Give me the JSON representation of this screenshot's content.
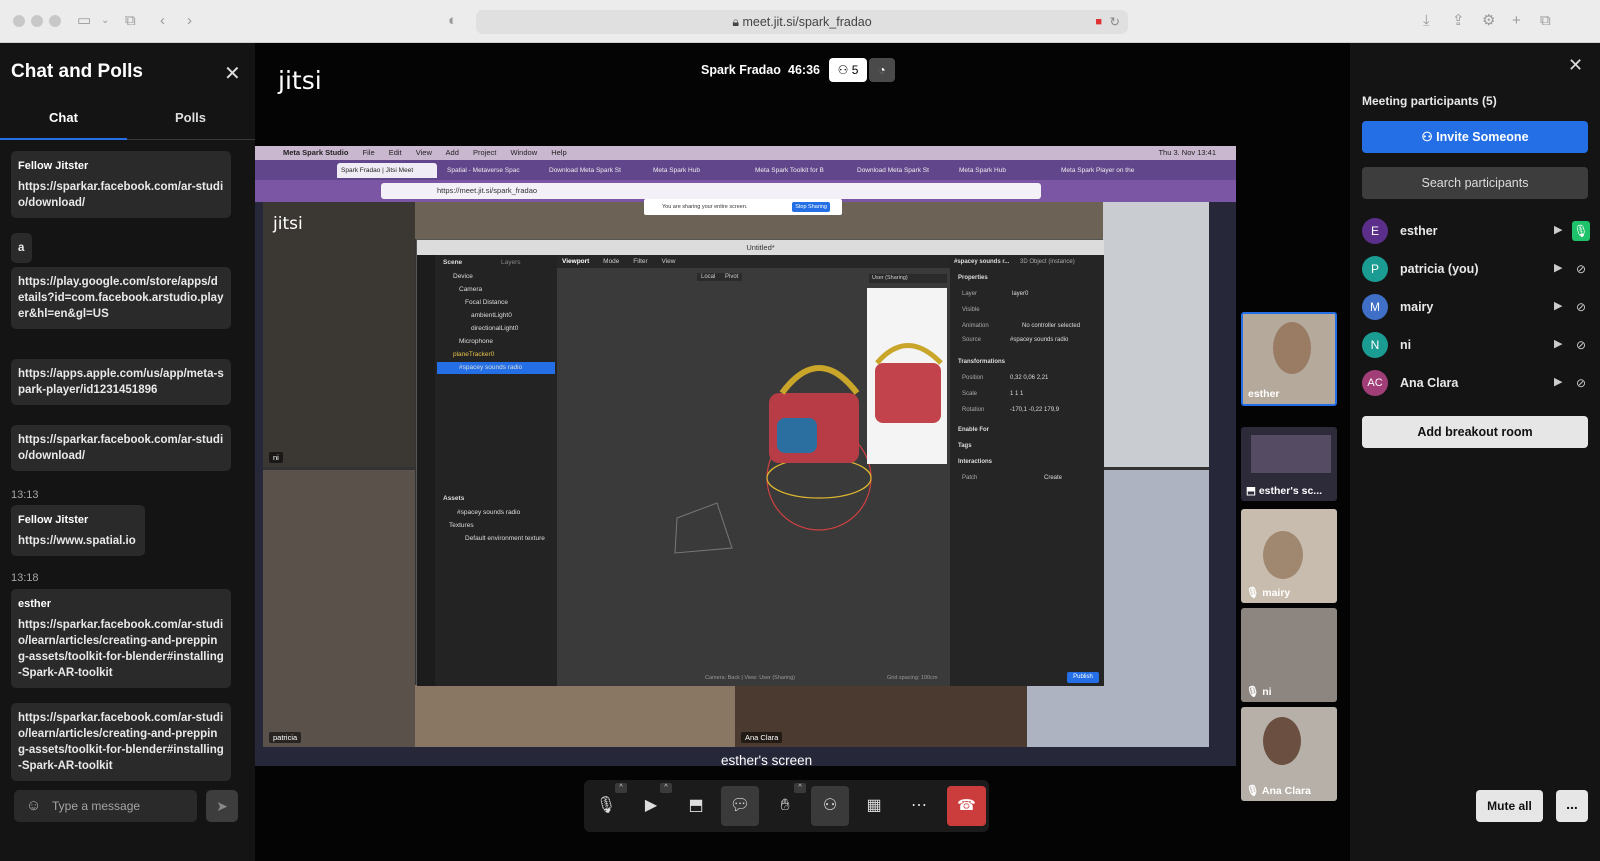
{
  "browser": {
    "url": "meet.jit.si/spark_fradao",
    "lock_icon": "lock-icon"
  },
  "chat": {
    "title": "Chat and Polls",
    "tabs": [
      {
        "label": "Chat"
      },
      {
        "label": "Polls"
      }
    ],
    "messages": [
      {
        "sender": "Fellow Jitster",
        "text": "https://sparkar.facebook.com/ar-studio/download/"
      },
      {
        "text": "a"
      },
      {
        "text": "https://play.google.com/store/apps/details?id=com.facebook.arstudio.player&hl=en&gl=US"
      },
      {
        "text": "https://apps.apple.com/us/app/meta-spark-player/id1231451896"
      },
      {
        "text": "https://sparkar.facebook.com/ar-studio/download/"
      },
      {
        "time": "13:13"
      },
      {
        "sender": "Fellow Jitster",
        "text": "https://www.spatial.io"
      },
      {
        "time": "13:18"
      },
      {
        "sender": "esther",
        "text": "https://sparkar.facebook.com/ar-studio/learn/articles/creating-and-prepping-assets/toolkit-for-blender#installing-Spark-AR-toolkit"
      },
      {
        "text": "https://sparkar.facebook.com/ar-studio/learn/articles/creating-and-prepping-assets/toolkit-for-blender#installing-Spark-AR-toolkit"
      }
    ],
    "input_placeholder": "Type a message"
  },
  "meeting": {
    "logo": "jitsi",
    "name": "Spark Fradao",
    "timer": "46:36",
    "participant_count": "5",
    "screen_caption": "esther's screen"
  },
  "shared_screen": {
    "mac_menu": [
      "Meta Spark Studio",
      "File",
      "Edit",
      "View",
      "Add",
      "Project",
      "Window",
      "Help"
    ],
    "mac_clock": "Thu 3. Nov 13:41",
    "browser_tabs": [
      "Spark Fradao | Jitsi Meet",
      "Spatial - Metaverse Spac",
      "Download Meta Spark St",
      "Meta Spark Hub",
      "Meta Spark Toolkit for B",
      "Download Meta Spark St",
      "Meta Spark Hub",
      "Meta Spark Player on the"
    ],
    "browser_url": "https://meet.jit.si/spark_fradao",
    "sharing_notice": "You are sharing your entire screen.",
    "stop_sharing": "Stop Sharing",
    "inner_logo": "jitsi",
    "tile_labels": [
      "ni",
      "patricia",
      "Ana Clara"
    ],
    "spark": {
      "title": "Untitled*",
      "scene_tabs": [
        "Scene",
        "Layers"
      ],
      "scene_items": [
        "Device",
        "Camera",
        "Focal Distance",
        "ambientLight0",
        "directionalLight0",
        "Microphone",
        "planeTracker0",
        "#spacey sounds radio"
      ],
      "assets_title": "Assets",
      "assets": [
        "#spacey sounds radio",
        "Textures",
        "Default environment texture"
      ],
      "viewport_tabs": [
        "Viewport",
        "Mode",
        "Filter",
        "View"
      ],
      "viewport_controls": [
        "Local",
        "Pivot"
      ],
      "preview_mode": "User (Sharing)",
      "status": "Camera: Back | View: User (Sharing)",
      "grid": "Grid spacing: 100cm",
      "props_title": "#spacey sounds r...",
      "props_type": "3D Object (instance)",
      "props": [
        {
          "label": "Properties"
        },
        {
          "label": "Layer",
          "value": "layer0"
        },
        {
          "label": "Visible"
        },
        {
          "label": "Animation",
          "value": "No controller selected"
        },
        {
          "label": "Source",
          "value": "#spacey sounds radio"
        },
        {
          "label": "Transformations"
        },
        {
          "label": "Position",
          "value": "0,32    0,06    2,21"
        },
        {
          "label": "Scale",
          "value": "1    1    1"
        },
        {
          "label": "Rotation",
          "value": "-170,1    -0,22    179,9"
        },
        {
          "label": "Enable For"
        },
        {
          "label": "Tags"
        },
        {
          "label": "Interactions"
        },
        {
          "label": "Patch",
          "value": "Create"
        }
      ],
      "publish": "Publish"
    }
  },
  "filmstrip": [
    {
      "name": "esther",
      "active": true
    },
    {
      "name": "esther's sc...",
      "screen": true
    },
    {
      "name": "mairy",
      "muted": true
    },
    {
      "name": "ni",
      "muted": true
    },
    {
      "name": "Ana Clara",
      "muted": true
    }
  ],
  "participants": {
    "title": "Meeting participants (5)",
    "invite_label": "Invite Someone",
    "search_label": "Search participants",
    "list": [
      {
        "initials": "E",
        "name": "esther",
        "color": "#5b2e8a",
        "mic": "on"
      },
      {
        "initials": "P",
        "name": "patricia (you)",
        "color": "#1a9c92",
        "mic": "muted"
      },
      {
        "initials": "M",
        "name": "mairy",
        "color": "#3f6fc6",
        "mic": "muted"
      },
      {
        "initials": "N",
        "name": "ni",
        "color": "#1a9c92",
        "mic": "muted"
      },
      {
        "initials": "AC",
        "name": "Ana Clara",
        "color": "#a13d77",
        "mic": "muted"
      }
    ],
    "breakout_label": "Add breakout room",
    "mute_all_label": "Mute all",
    "more_label": "..."
  },
  "colors": {
    "accent": "#246fe5",
    "hangup": "#cb3c3d",
    "mic_on": "#1ec26a"
  }
}
